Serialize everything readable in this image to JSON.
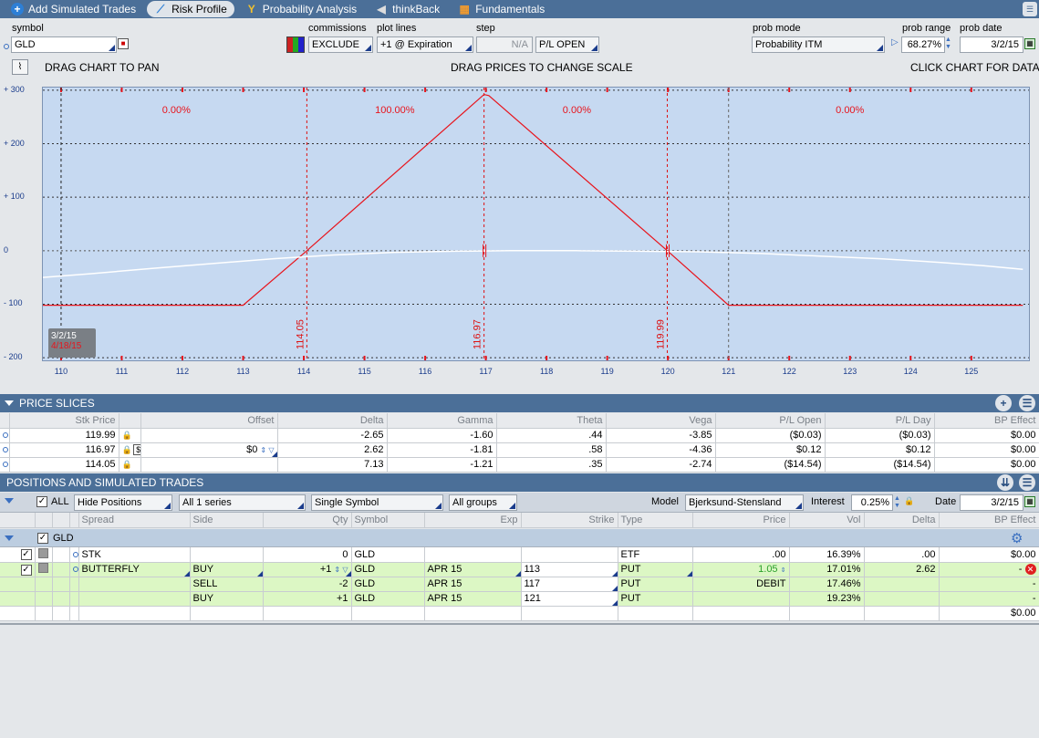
{
  "tabs": [
    {
      "label": "Add Simulated Trades",
      "icon": "plus-icon"
    },
    {
      "label": "Risk Profile",
      "icon": "risk-profile-icon"
    },
    {
      "label": "Probability Analysis",
      "icon": "probability-icon"
    },
    {
      "label": "thinkBack",
      "icon": "thinkback-icon"
    },
    {
      "label": "Fundamentals",
      "icon": "fundamentals-icon"
    }
  ],
  "controls": {
    "symbol_label": "symbol",
    "symbol_value": "GLD",
    "commissions_label": "commissions",
    "commissions_value": "EXCLUDE",
    "plotlines_label": "plot lines",
    "plotlines_value": "+1 @ Expiration",
    "step_label": "step",
    "step_value": "N/A",
    "plmode_value": "P/L OPEN",
    "probmode_label": "prob mode",
    "probmode_value": "Probability ITM",
    "probrange_label": "prob range",
    "probrange_value": "68.27%",
    "probdate_label": "prob date",
    "probdate_value": "3/2/15",
    "drag_pan": "DRAG CHART TO PAN",
    "drag_prices": "DRAG PRICES TO CHANGE SCALE",
    "click_chart": "CLICK CHART FOR DATA"
  },
  "chart_data": {
    "type": "line",
    "xlim": [
      109.7,
      125.95
    ],
    "ylim": [
      -205,
      305
    ],
    "x_ticks": [
      110,
      111,
      112,
      113,
      114,
      115,
      116,
      117,
      118,
      119,
      120,
      121,
      122,
      123,
      124,
      125
    ],
    "y_ticks": [
      {
        "v": 300,
        "label": "+ 300"
      },
      {
        "v": 200,
        "label": "+ 200"
      },
      {
        "v": 100,
        "label": "+ 100"
      },
      {
        "v": 0,
        "label": "0"
      },
      {
        "v": -100,
        "label": "- 100"
      },
      {
        "v": -200,
        "label": "- 200"
      }
    ],
    "series": [
      {
        "color": "#e8141c",
        "x": [
          109.7,
          113,
          114.05,
          116.97,
          117.05,
          119.99,
          121,
          125.85
        ],
        "y": [
          -102,
          -102,
          0,
          292,
          290,
          0,
          -102,
          -102
        ]
      },
      {
        "color": "#ffffff",
        "x": [
          109.7,
          110.5,
          111.5,
          112.5,
          113.5,
          114.5,
          115.5,
          116.5,
          117.4,
          118.5,
          119.5,
          120.5,
          121.5,
          122.5,
          123.5,
          124.5,
          125.2,
          125.85
        ],
        "y": [
          -50,
          -43,
          -33,
          -24,
          -15,
          -8,
          -3,
          -1,
          0,
          0,
          -1,
          -2,
          -5,
          -10,
          -15,
          -22,
          -28,
          -35
        ]
      }
    ],
    "vlines": [
      {
        "x": 110,
        "color": "#222222",
        "label": ""
      },
      {
        "x": 114.05,
        "color": "#d11",
        "label": "114.05"
      },
      {
        "x": 116.97,
        "color": "#d11",
        "label": "116.97"
      },
      {
        "x": 119.99,
        "color": "#d11",
        "label": "119.99"
      },
      {
        "x": 121,
        "color": "#666666",
        "label": ""
      }
    ],
    "region_labels": [
      {
        "x": 111.9,
        "text": "0.00%"
      },
      {
        "x": 115.5,
        "text": "100.00%"
      },
      {
        "x": 118.5,
        "text": "0.00%"
      },
      {
        "x": 123,
        "text": "0.00%"
      }
    ],
    "date_labels": [
      "3/2/15",
      "4/18/15"
    ]
  },
  "price_slices": {
    "title": "PRICE SLICES",
    "headers": [
      "Stk Price",
      "Offset",
      "Delta",
      "Gamma",
      "Theta",
      "Vega",
      "P/L Open",
      "P/L Day",
      "BP Effect"
    ],
    "rows": [
      [
        "119.99",
        "",
        "-2.65",
        "-1.60",
        ".44",
        "-3.85",
        "($0.03)",
        "($0.03)",
        "$0.00"
      ],
      [
        "116.97",
        "$0",
        "2.62",
        "-1.81",
        ".58",
        "-4.36",
        "$0.12",
        "$0.12",
        "$0.00"
      ],
      [
        "114.05",
        "",
        "7.13",
        "-1.21",
        ".35",
        "-2.74",
        "($14.54)",
        "($14.54)",
        "$0.00"
      ]
    ]
  },
  "positions": {
    "title": "POSITIONS AND SIMULATED TRADES",
    "all_label": "ALL",
    "hide_positions": "Hide Positions",
    "series": "All 1 series",
    "symbol_mode": "Single Symbol",
    "groups": "All groups",
    "model_label": "Model",
    "model_value": "Bjerksund-Stensland",
    "interest_label": "Interest",
    "interest_value": "0.25%",
    "date_label": "Date",
    "date_value": "3/2/15",
    "headers": [
      "Spread",
      "Side",
      "Qty",
      "Symbol",
      "Exp",
      "Strike",
      "Type",
      "Price",
      "Vol",
      "Delta",
      "BP Effect"
    ],
    "group": "GLD",
    "rows": [
      {
        "spread": "STK",
        "side": "",
        "qty": "0",
        "symbol": "GLD",
        "exp": "",
        "strike": "",
        "type": "ETF",
        "price": ".00",
        "vol": "16.39%",
        "delta": ".00",
        "bp": "$0.00"
      },
      {
        "spread": "BUTTERFLY",
        "side": "BUY",
        "qty": "+1",
        "symbol": "GLD",
        "exp": "APR 15",
        "strike": "113",
        "type": "PUT",
        "price": "1.05",
        "vol": "17.01%",
        "delta": "2.62",
        "bp": "-"
      },
      {
        "spread": "",
        "side": "SELL",
        "qty": "-2",
        "symbol": "GLD",
        "exp": "APR 15",
        "strike": "117",
        "type": "PUT",
        "price": "DEBIT",
        "vol": "17.46%",
        "delta": "",
        "bp": "-"
      },
      {
        "spread": "",
        "side": "BUY",
        "qty": "+1",
        "symbol": "GLD",
        "exp": "APR 15",
        "strike": "121",
        "type": "PUT",
        "price": "",
        "vol": "19.23%",
        "delta": "",
        "bp": "-"
      }
    ],
    "total_bp": "$0.00"
  }
}
